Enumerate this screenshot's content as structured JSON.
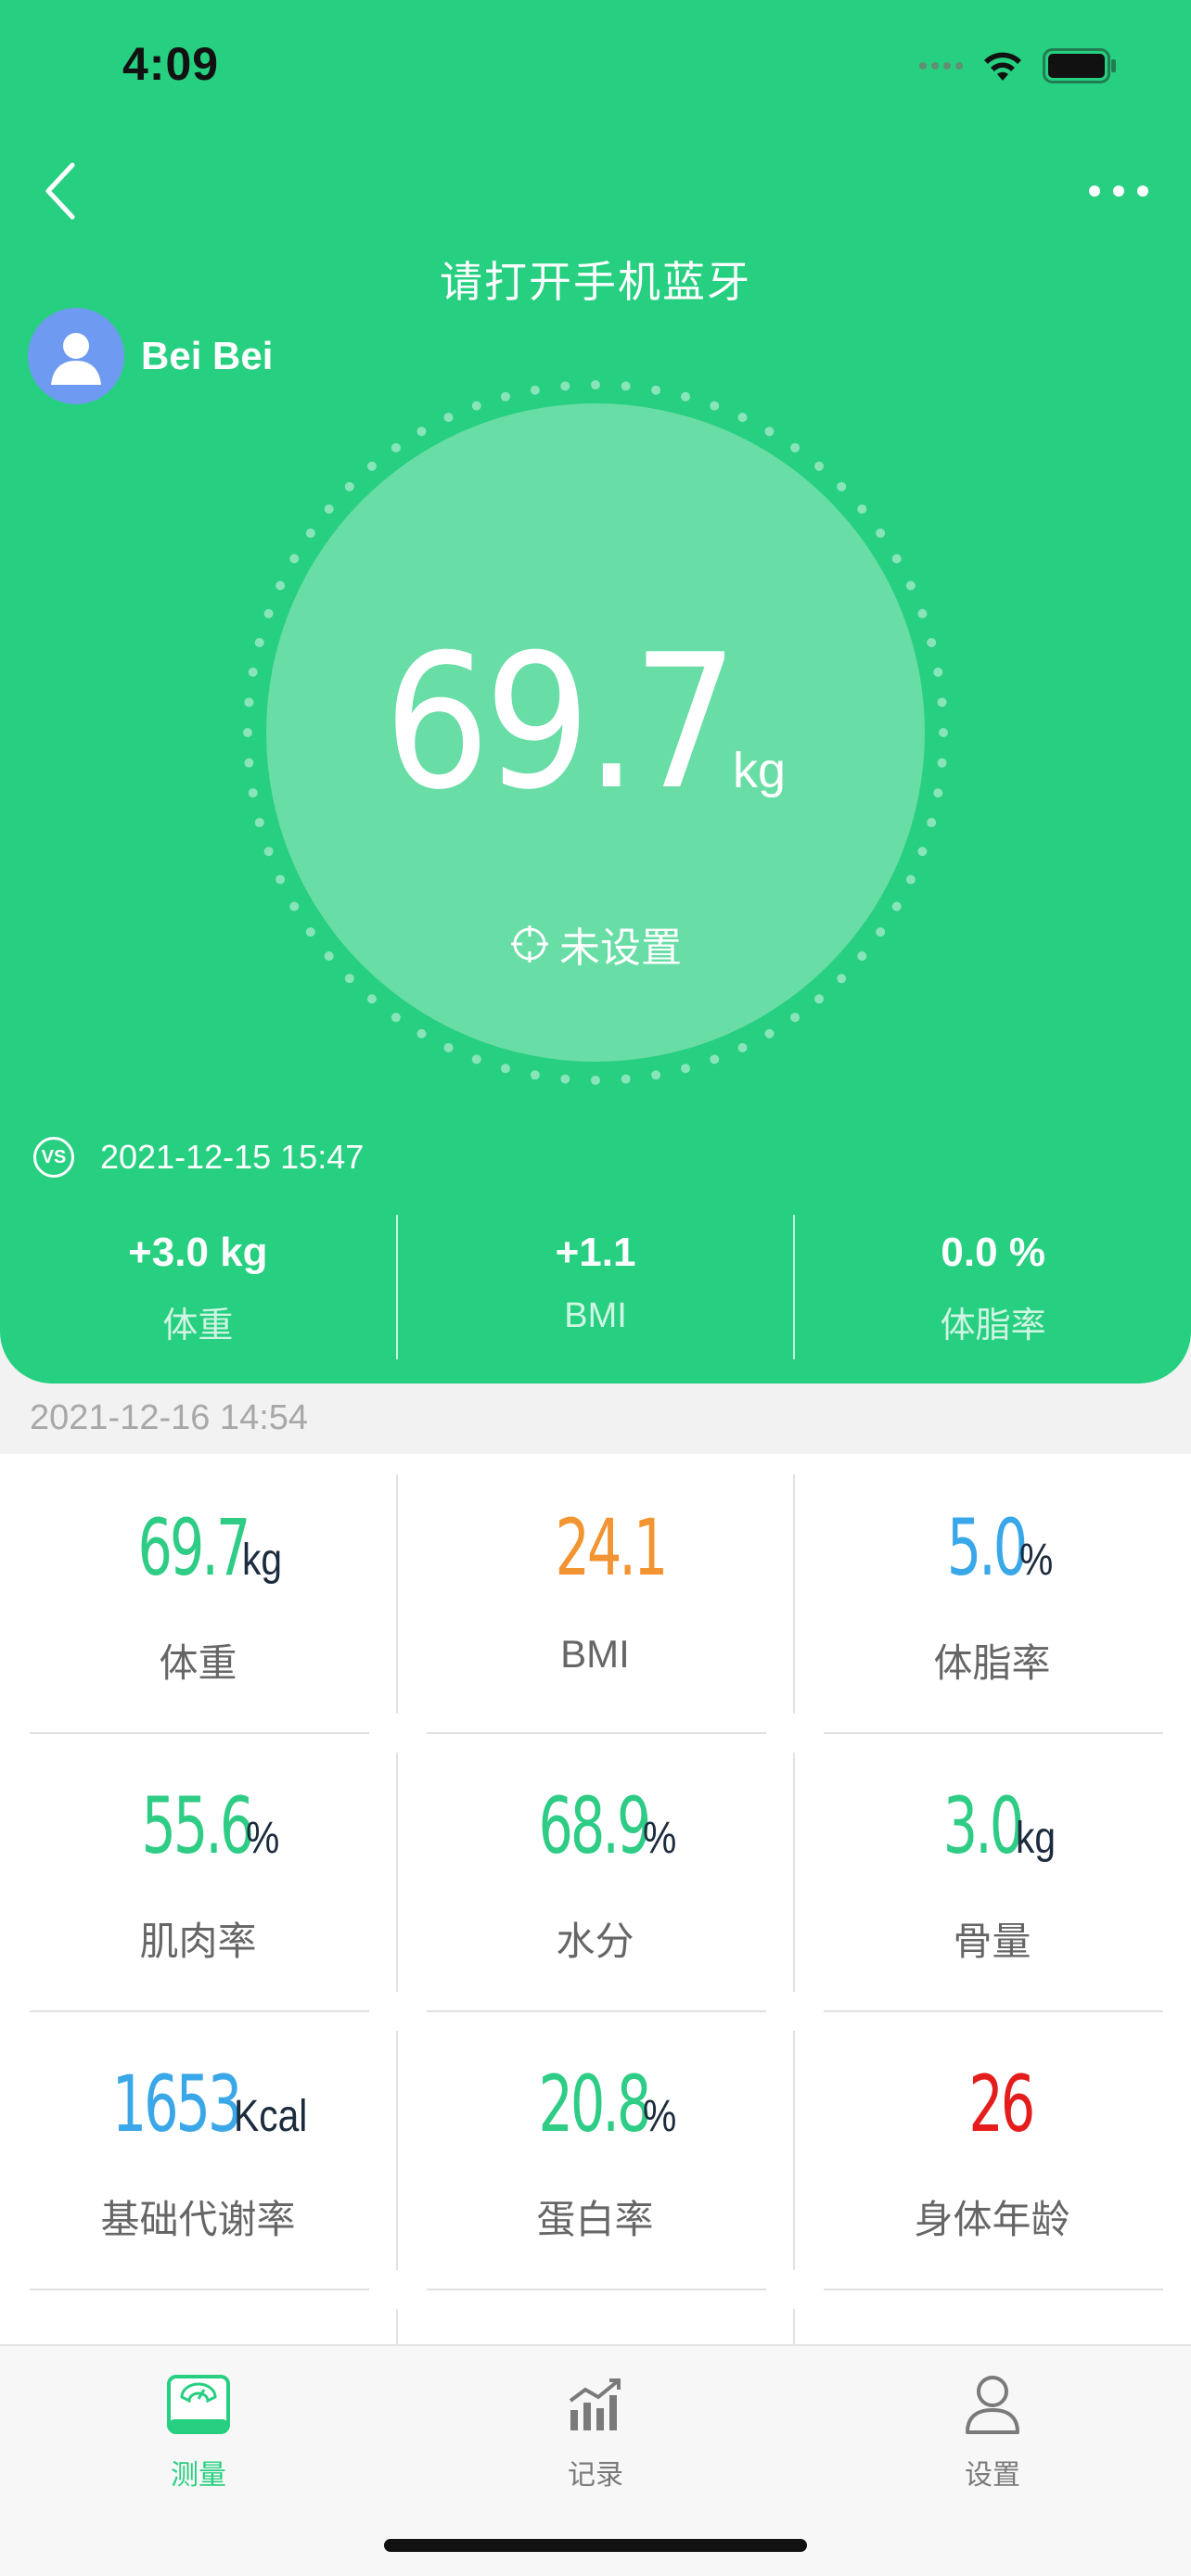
{
  "status_bar": {
    "time": "4:09"
  },
  "header": {
    "title": "请打开手机蓝牙",
    "user_name": "Bei Bei",
    "weight_value": "69.7",
    "weight_unit": "kg",
    "target_label": "未设置",
    "compare_time": "2021-12-15 15:47",
    "compare": [
      {
        "value": "+3.0 kg",
        "label": "体重"
      },
      {
        "value": "+1.1",
        "label": "BMI"
      },
      {
        "value": "0.0 %",
        "label": "体脂率"
      }
    ]
  },
  "record_time": "2021-12-16 14:54",
  "metrics": [
    {
      "value": "69.7",
      "unit": "kg",
      "label": "体重",
      "color": "#2ecc85"
    },
    {
      "value": "24.1",
      "unit": "",
      "label": "BMI",
      "color": "#f39432"
    },
    {
      "value": "5.0",
      "unit": "%",
      "label": "体脂率",
      "color": "#3aa7e8"
    },
    {
      "value": "55.6",
      "unit": "%",
      "label": "肌肉率",
      "color": "#2ecc85"
    },
    {
      "value": "68.9",
      "unit": "%",
      "label": "水分",
      "color": "#2ecc85"
    },
    {
      "value": "3.0",
      "unit": "kg",
      "label": "骨量",
      "color": "#2ecc85"
    },
    {
      "value": "1653",
      "unit": "Kcal",
      "label": "基础代谢率",
      "color": "#3aa7e8"
    },
    {
      "value": "20.8",
      "unit": "%",
      "label": "蛋白率",
      "color": "#2ecc85"
    },
    {
      "value": "26",
      "unit": "",
      "label": "身体年龄",
      "color": "#e51c1c"
    }
  ],
  "tabs": [
    {
      "label": "测量",
      "icon": "scale-icon",
      "active": true
    },
    {
      "label": "记录",
      "icon": "chart-icon",
      "active": false
    },
    {
      "label": "设置",
      "icon": "person-icon",
      "active": false
    }
  ],
  "colors": {
    "brand": "#27cf80",
    "inner_circle": "#68dda5",
    "avatar": "#6f9af2"
  }
}
